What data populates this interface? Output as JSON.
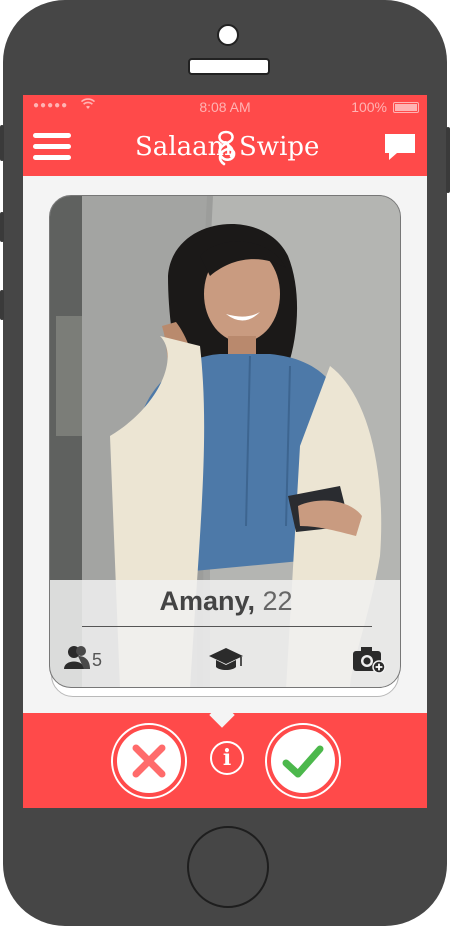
{
  "status_bar": {
    "signal": "●●●●●",
    "time": "8:08 AM",
    "battery": "100%"
  },
  "app": {
    "logo_left": "Salaam",
    "logo_right": "Swipe"
  },
  "profile": {
    "name": "Amany,",
    "age": "22",
    "mutual_friends": "5"
  },
  "actions": {
    "info_label": "i"
  },
  "colors": {
    "brand_red": "#ff4a4a",
    "nope_red": "#ff6b6b",
    "like_green": "#4cb84c"
  },
  "icons": [
    "menu-icon",
    "chat-bubble-icon",
    "friends-icon",
    "graduation-cap-icon",
    "add-photo-icon",
    "close-icon",
    "check-icon",
    "info-icon"
  ]
}
